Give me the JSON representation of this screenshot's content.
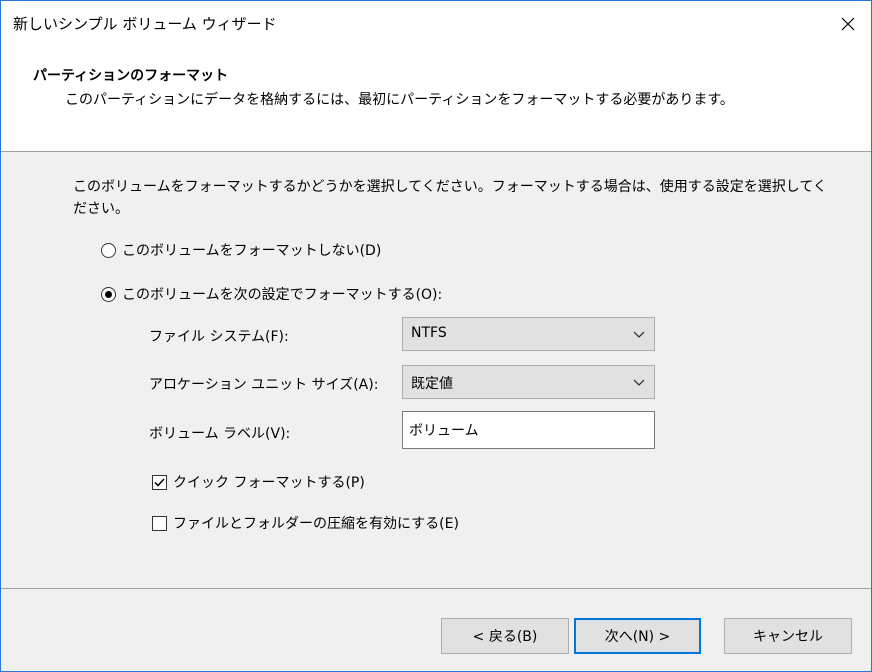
{
  "window": {
    "title": "新しいシンプル ボリューム ウィザード"
  },
  "header": {
    "title": "パーティションのフォーマット",
    "subtitle": "このパーティションにデータを格納するには、最初にパーティションをフォーマットする必要があります。"
  },
  "instruction": "このボリュームをフォーマットするかどうかを選択してください。フォーマットする場合は、使用する設定を選択してください。",
  "options": {
    "no_format": {
      "label": "このボリュームをフォーマットしない(D)",
      "selected": false
    },
    "format": {
      "label": "このボリュームを次の設定でフォーマットする(O):",
      "selected": true
    }
  },
  "fields": {
    "filesystem": {
      "label": "ファイル システム(F):",
      "value": "NTFS"
    },
    "alloc_unit": {
      "label": "アロケーション ユニット サイズ(A):",
      "value": "既定値"
    },
    "volume_label": {
      "label": "ボリューム ラベル(V):",
      "value": "ボリューム"
    }
  },
  "checkboxes": {
    "quick_format": {
      "label": "クイック フォーマットする(P)",
      "checked": true
    },
    "compression": {
      "label": "ファイルとフォルダーの圧縮を有効にする(E)",
      "checked": false
    }
  },
  "buttons": {
    "back": "< 戻る(B)",
    "next": "次へ(N) >",
    "cancel": "キャンセル"
  },
  "icons": {
    "close": "close-icon",
    "dropdown": "chevron-down-icon",
    "check": "check-icon"
  },
  "colors": {
    "window_border": "#2b79d6",
    "default_button_border": "#0078d7",
    "dialog_bg": "#f0f0f0"
  }
}
